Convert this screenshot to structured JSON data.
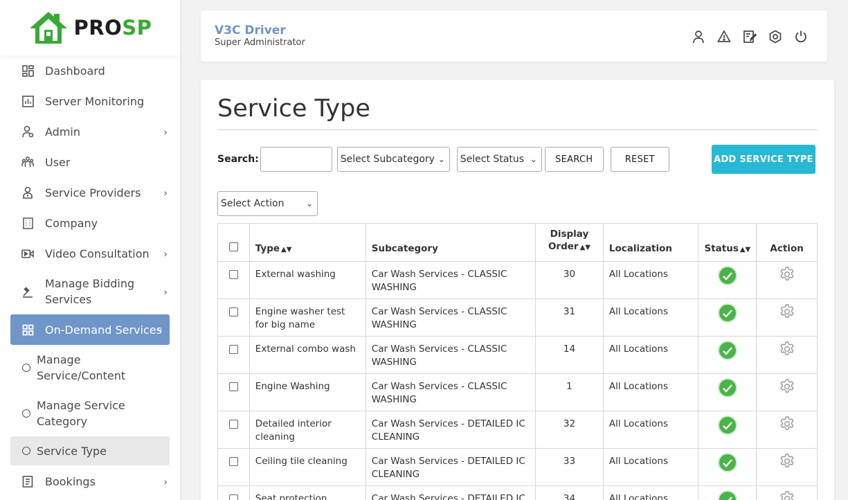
{
  "brand": {
    "pro": "PRO",
    "sp": "SP",
    "green": "#39a935",
    "dark": "#1e1e1e"
  },
  "sidebar": {
    "items": [
      {
        "label": "Dashboard",
        "icon": "dashboard-icon"
      },
      {
        "label": "Server Monitoring",
        "icon": "chart-icon"
      },
      {
        "label": "Admin",
        "icon": "admin-icon",
        "caret": "›"
      },
      {
        "label": "User",
        "icon": "users-icon"
      },
      {
        "label": "Service Providers",
        "icon": "provider-icon",
        "caret": "›"
      },
      {
        "label": "Company",
        "icon": "building-icon"
      },
      {
        "label": "Video Consultation",
        "icon": "video-icon",
        "caret": "›"
      },
      {
        "label": "Manage Bidding Services",
        "icon": "gavel-icon",
        "caret": "›"
      },
      {
        "label": "On-Demand Services",
        "icon": "grid-icon",
        "caret": "⌄"
      }
    ],
    "subitems": [
      {
        "label": "Manage Service/Content"
      },
      {
        "label": "Manage Service Category"
      },
      {
        "label": "Service Type"
      }
    ],
    "bookings": {
      "label": "Bookings",
      "icon": "bookings-icon",
      "caret": "›"
    },
    "active_color": "#6f95c9"
  },
  "header": {
    "user_name": "V3C Driver",
    "user_role": "Super Administrator",
    "icons": [
      "user-icon",
      "alert-icon",
      "edit-icon",
      "settings-icon",
      "power-icon"
    ]
  },
  "page": {
    "title": "Service Type",
    "search_label": "Search:",
    "search_value": "",
    "subcategory_select": "Select Subcategory",
    "status_select": "Select Status",
    "search_button": "SEARCH",
    "reset_button": "RESET",
    "add_button": "ADD SERVICE TYPE",
    "action_select": "Select Action",
    "accent": "#26b8d5"
  },
  "table": {
    "headers": {
      "type": "Type",
      "subcategory": "Subcategory",
      "display_order_1": "Display",
      "display_order_2": "Order",
      "localization": "Localization",
      "status": "Status",
      "action": "Action"
    },
    "rows": [
      {
        "type": "External washing",
        "subcategory": "Car Wash Services - CLASSIC WASHING",
        "order": "30",
        "localization": "All Locations",
        "status": "active"
      },
      {
        "type": "Engine washer test for big name",
        "subcategory": "Car Wash Services - CLASSIC WASHING",
        "order": "31",
        "localization": "All Locations",
        "status": "active"
      },
      {
        "type": "External combo wash",
        "subcategory": "Car Wash Services - CLASSIC WASHING",
        "order": "14",
        "localization": "All Locations",
        "status": "active"
      },
      {
        "type": "Engine Washing",
        "subcategory": "Car Wash Services - CLASSIC WASHING",
        "order": "1",
        "localization": "All Locations",
        "status": "active"
      },
      {
        "type": "Detailed interior cleaning",
        "subcategory": "Car Wash Services - DETAILED IC CLEANING",
        "order": "32",
        "localization": "All Locations",
        "status": "active"
      },
      {
        "type": "Ceiling tile cleaning",
        "subcategory": "Car Wash Services - DETAILED IC CLEANING",
        "order": "33",
        "localization": "All Locations",
        "status": "active"
      },
      {
        "type": "Seat protection",
        "subcategory": "Car Wash Services - DETAILED IC CLEANING",
        "order": "34",
        "localization": "All Locations",
        "status": "active"
      }
    ],
    "status_color": "#49b548"
  }
}
